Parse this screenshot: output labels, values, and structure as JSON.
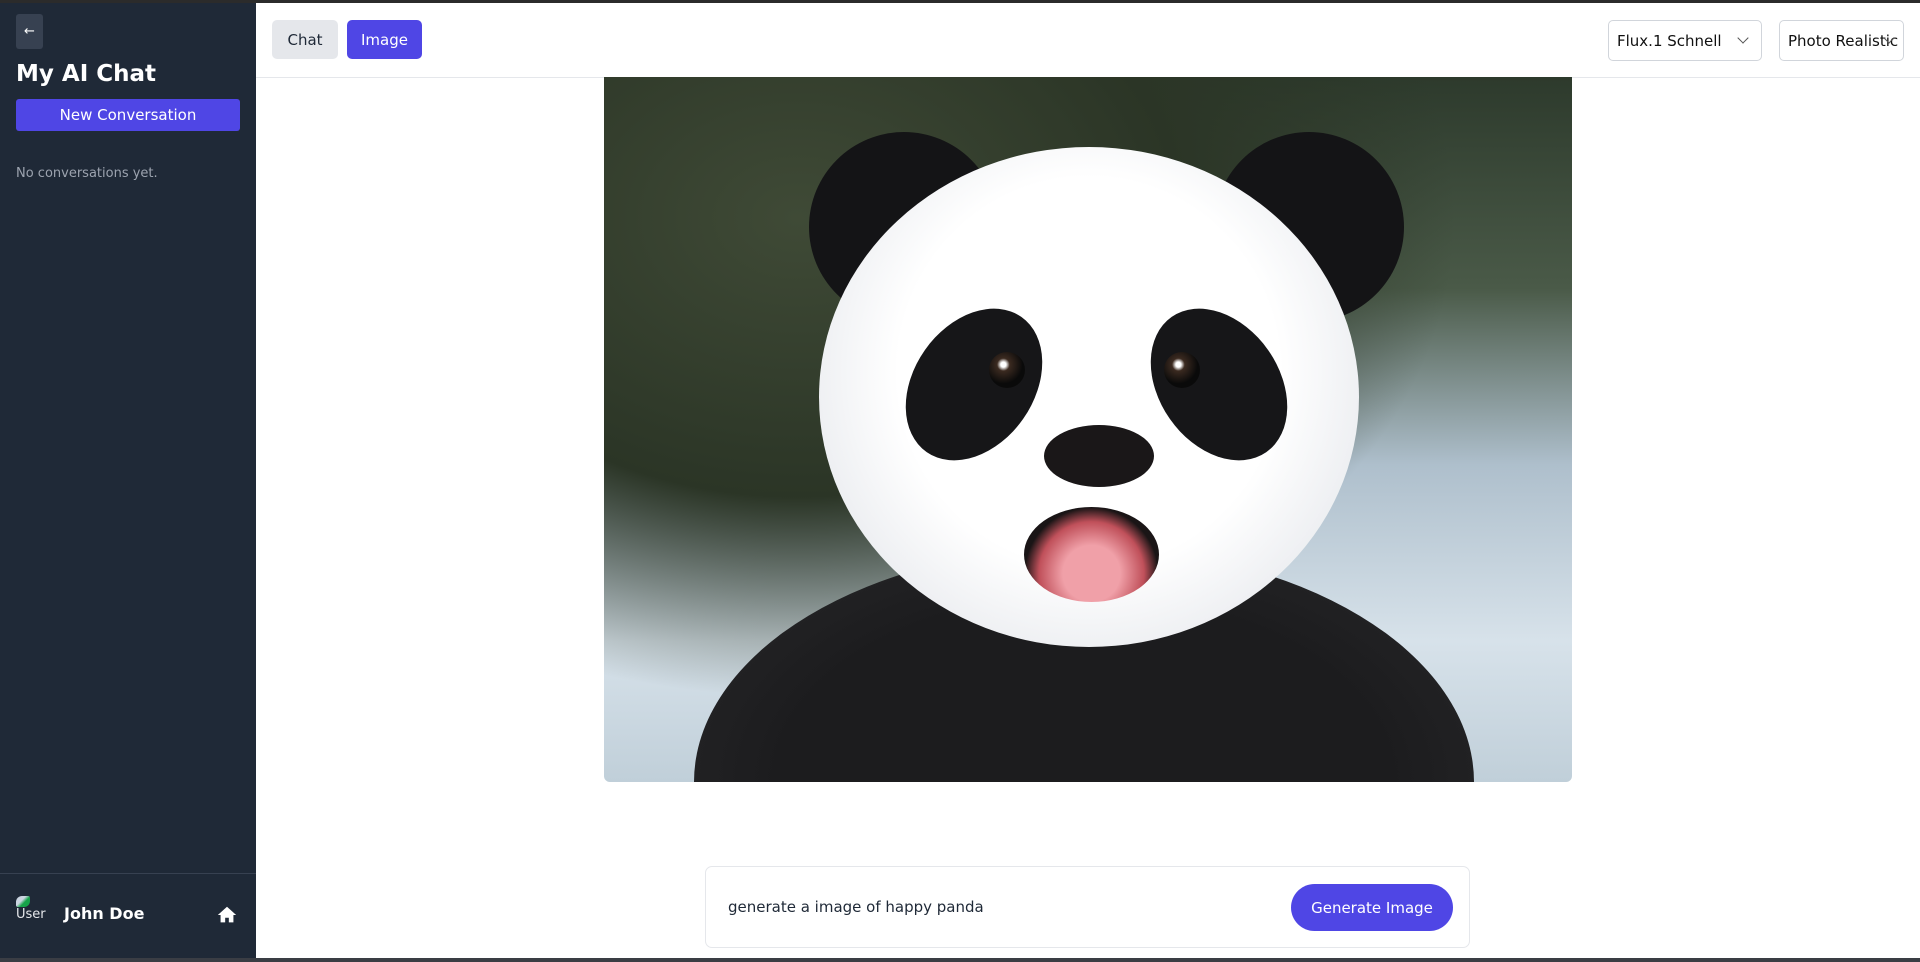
{
  "sidebar": {
    "back_icon": "arrow-left-icon",
    "title": "My AI Chat",
    "new_conversation": "New Conversation",
    "empty_text": "No conversations yet.",
    "user": {
      "avatar_alt": "User",
      "name": "John Doe"
    },
    "home_icon": "home-icon"
  },
  "header": {
    "tabs": [
      {
        "label": "Chat",
        "active": false
      },
      {
        "label": "Image",
        "active": true
      }
    ],
    "model_select": "Flux.1 Schnell",
    "style_select": "Photo Realistic"
  },
  "composer": {
    "prompt_value": "generate a image of happy panda",
    "generate_label": "Generate Image"
  },
  "colors": {
    "accent": "#4f46e5",
    "sidebar_bg": "#1f2937"
  }
}
